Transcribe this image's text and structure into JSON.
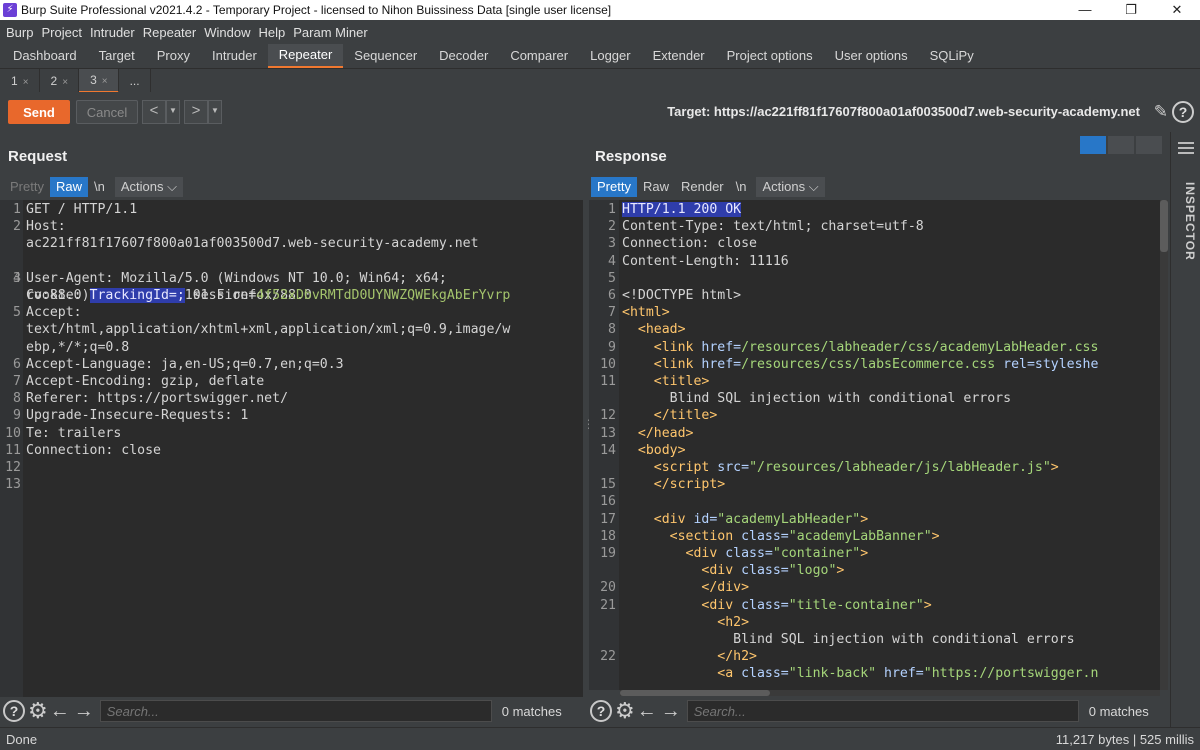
{
  "window": {
    "title": "Burp Suite Professional v2021.4.2 - Temporary Project - licensed to Nihon Buissiness Data [single user license]",
    "minimize": "—",
    "restore": "❐",
    "close": "✕",
    "app_icon": "⚡"
  },
  "menu": [
    "Burp",
    "Project",
    "Intruder",
    "Repeater",
    "Window",
    "Help",
    "Param Miner"
  ],
  "main_tabs": [
    "Dashboard",
    "Target",
    "Proxy",
    "Intruder",
    "Repeater",
    "Sequencer",
    "Decoder",
    "Comparer",
    "Logger",
    "Extender",
    "Project options",
    "User options",
    "SQLiPy"
  ],
  "active_main_tab": "Repeater",
  "sub_tabs": [
    {
      "label": "1",
      "close": "×"
    },
    {
      "label": "2",
      "close": "×"
    },
    {
      "label": "3",
      "close": "×"
    },
    {
      "label": "...",
      "close": ""
    }
  ],
  "toolbar": {
    "send_label": "Send",
    "cancel_label": "Cancel",
    "back_icon": "<",
    "forward_icon": ">",
    "dropdown_icon": "▼",
    "target_label": "Target: https://ac221ff81f17607f800a01af003500d7.web-security-academy.net",
    "edit_icon": "✎",
    "help_icon": "?"
  },
  "request": {
    "title": "Request",
    "tabs": {
      "pretty": "Pretty",
      "raw": "Raw",
      "newline": "\\n",
      "actions": "Actions ⌵"
    },
    "line_numbers": [
      "1",
      "2",
      "",
      "3",
      "4",
      "",
      "5",
      "",
      "",
      "6",
      "7",
      "8",
      "9",
      "10",
      "11",
      "12",
      "13"
    ],
    "lines": [
      "GET / HTTP/1.1",
      "Host:",
      "ac221ff81f17607f800a01af003500d7.web-security-academy.net",
      "",
      "User-Agent: Mozilla/5.0 (Windows NT 10.0; Win64; x64;",
      "rv:88.0) Gecko/20100101 Firefox/88.0",
      "Accept:",
      "text/html,application/xhtml+xml,application/xml;q=0.9,image/w",
      "ebp,*/*;q=0.8",
      "Accept-Language: ja,en-US;q=0.7,en;q=0.3",
      "Accept-Encoding: gzip, deflate",
      "Referer: https://portswigger.net/",
      "Upgrade-Insecure-Requests: 1",
      "Te: trailers",
      "Connection: close",
      "",
      ""
    ],
    "cookie": {
      "prefix": "Cookie: ",
      "highlight": "TrackingId=;",
      "middle": " session=",
      "session_value": "4f52xDbvRMTdD0UYNWZQWEkgAbErYvrp"
    }
  },
  "response": {
    "title": "Response",
    "tabs": {
      "pretty": "Pretty",
      "raw": "Raw",
      "render": "Render",
      "newline": "\\n",
      "actions": "Actions ⌵"
    },
    "line_numbers": [
      "1",
      "2",
      "3",
      "4",
      "5",
      "6",
      "7",
      "8",
      "9",
      "10",
      "11",
      "",
      "12",
      "13",
      "14",
      "",
      "15",
      "16",
      "17",
      "18",
      "19",
      "",
      "20",
      "21",
      "",
      "22"
    ],
    "status_line": "HTTP/1.1 200 OK",
    "headers": [
      "Content-Type: text/html; charset=utf-8",
      "Connection: close",
      "Content-Length: 11116"
    ],
    "title_text": "Blind SQL injection with conditional errors",
    "html_lines": {
      "doctype": "<!DOCTYPE html>",
      "css1": "/resources/labheader/css/academyLabHeader.css",
      "css2": "/resources/css/labsEcommerce.css",
      "rel": " rel=styleshe",
      "script_src": "\"/resources/labheader/js/labHeader.js\"",
      "div_id": "\"academyLabHeader\"",
      "section_class": "\"academyLabBanner\"",
      "container_class": "\"container\"",
      "logo_class": "\"logo\"",
      "title_container_class": "\"title-container\"",
      "link_back_class": "\"link-back\"",
      "href_portswigger": "\"https://portswigger.n"
    }
  },
  "search": {
    "placeholder": "Search...",
    "matches": "0 matches",
    "help_icon": "?",
    "settings_icon": "⚙",
    "prev_icon": "←",
    "next_icon": "→"
  },
  "inspector": {
    "label": "INSPECTOR"
  },
  "status": {
    "left": "Done",
    "right": "11,217 bytes | 525 millis"
  }
}
